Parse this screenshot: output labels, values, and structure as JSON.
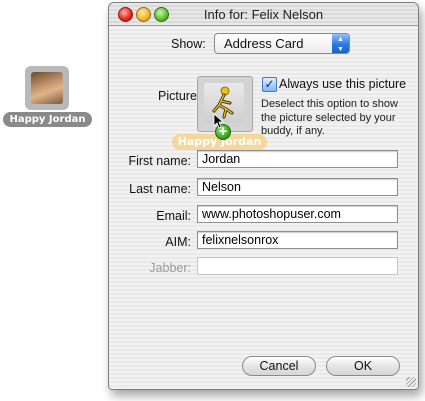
{
  "desktop": {
    "item_label": "Happy Jordan"
  },
  "window": {
    "title": "Info for: Felix Nelson"
  },
  "show": {
    "label": "Show:",
    "selected": "Address Card"
  },
  "picture": {
    "label": "Picture:",
    "drag_label": "Happy Jordan",
    "always_use_label": "Always use this picture",
    "always_use_checked": true,
    "help_text": "Deselect this option to show the picture selected by your buddy, if any."
  },
  "fields": {
    "first_name": {
      "label": "First name:",
      "value": "Jordan"
    },
    "last_name": {
      "label": "Last name:",
      "value": "Nelson"
    },
    "email": {
      "label": "Email:",
      "value": "www.photoshopuser.com"
    },
    "aim": {
      "label": "AIM:",
      "value": "felixnelsonrox"
    },
    "jabber": {
      "label": "Jabber:",
      "value": ""
    }
  },
  "buttons": {
    "cancel": "Cancel",
    "ok": "OK"
  },
  "colors": {
    "accent_blue": "#2a7ae4",
    "drag_badge": "#f6cd78",
    "add_badge": "#2e9a1a"
  }
}
